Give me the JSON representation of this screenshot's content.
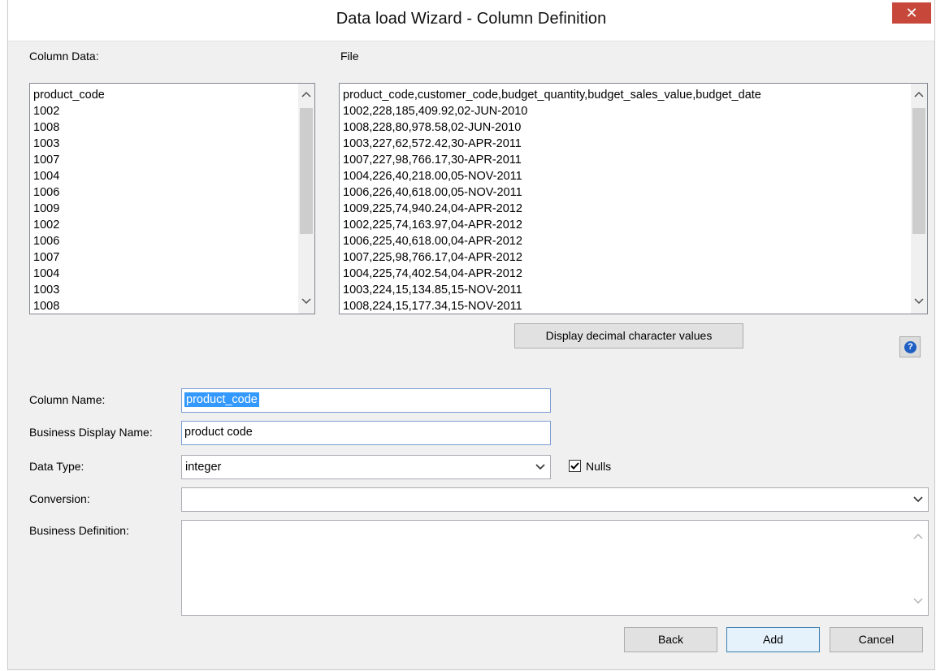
{
  "window": {
    "title": "Data load Wizard - Column Definition",
    "close_glyph": "✕"
  },
  "column_data": {
    "label": "Column Data:",
    "items": [
      "product_code",
      "1002",
      "1008",
      "1003",
      "1007",
      "1004",
      "1006",
      "1009",
      "1002",
      "1006",
      "1007",
      "1004",
      "1003",
      "1008"
    ]
  },
  "file": {
    "label": "File",
    "lines": [
      "product_code,customer_code,budget_quantity,budget_sales_value,budget_date",
      "1002,228,185,409.92,02-JUN-2010",
      "1008,228,80,978.58,02-JUN-2010",
      "1003,227,62,572.42,30-APR-2011",
      "1007,227,98,766.17,30-APR-2011",
      "1004,226,40,218.00,05-NOV-2011",
      "1006,226,40,618.00,05-NOV-2011",
      "1009,225,74,940.24,04-APR-2012",
      "1002,225,74,163.97,04-APR-2012",
      "1006,225,40,618.00,04-APR-2012",
      "1007,225,98,766.17,04-APR-2012",
      "1004,225,74,402.54,04-APR-2012",
      "1003,224,15,134.85,15-NOV-2011",
      "1008,224,15,177.34,15-NOV-2011"
    ]
  },
  "display_decimal_button": "Display decimal character values",
  "help_glyph": "?",
  "form": {
    "column_name_label": "Column Name:",
    "column_name_value": "product_code",
    "business_display_name_label": "Business Display Name:",
    "business_display_name_value": "product code",
    "data_type_label": "Data Type:",
    "data_type_value": "integer",
    "nulls_label": "Nulls",
    "nulls_checked": true,
    "conversion_label": "Conversion:",
    "conversion_value": "",
    "business_definition_label": "Business Definition:",
    "business_definition_value": ""
  },
  "buttons": {
    "back": "Back",
    "add": "Add",
    "cancel": "Cancel"
  },
  "icons": {
    "scroll_up": "▲",
    "scroll_down": "▼",
    "dropdown": "chevron-down"
  }
}
